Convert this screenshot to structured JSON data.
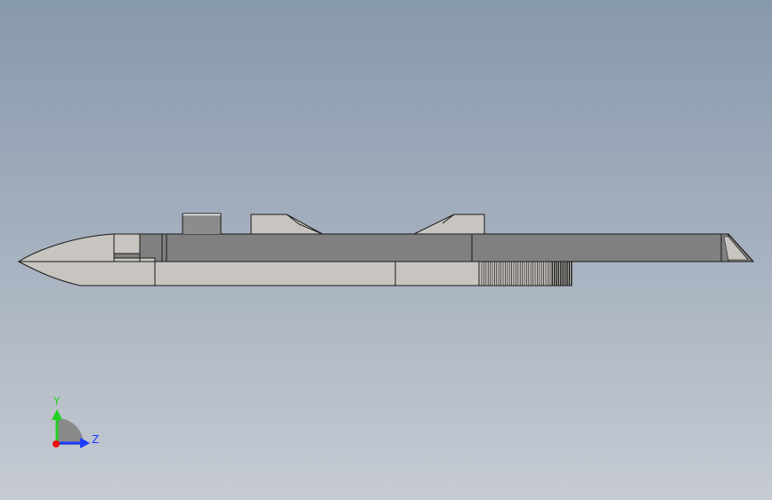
{
  "viewport": {
    "background_top": "#8799ad",
    "background_bottom": "#c6cbd3"
  },
  "model": {
    "body_color": "#808080",
    "light_part_color": "#c8c5c0",
    "edge_color": "#1a1a1a"
  },
  "triad": {
    "y_label": "Y",
    "z_label": "Z",
    "y_color": "#22d022",
    "z_color": "#1a3cff",
    "x_color": "#ee1111"
  }
}
